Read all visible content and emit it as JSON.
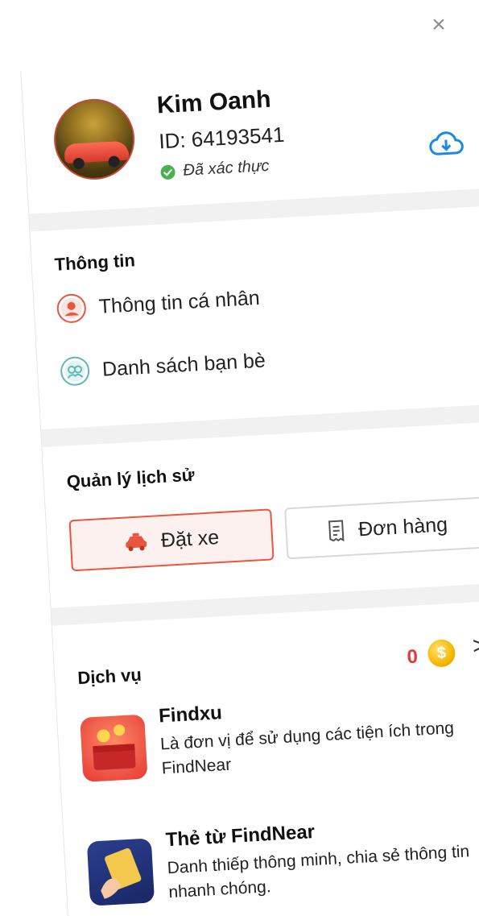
{
  "header": {
    "close_label": "×",
    "name": "Kim Oanh",
    "id_text": "ID: 64193541",
    "verified_text": "Đã xác thực",
    "download_icon": "cloud-download-icon"
  },
  "info": {
    "title": "Thông tin",
    "items": [
      {
        "label": "Thông tin cá nhân",
        "icon": "user-circle-icon"
      },
      {
        "label": "Danh sách bạn bè",
        "icon": "friends-icon"
      }
    ]
  },
  "history": {
    "title": "Quản lý lịch sử",
    "tabs": [
      {
        "label": "Đặt xe",
        "icon": "taxi-icon",
        "active": true
      },
      {
        "label": "Đơn hàng",
        "icon": "receipt-icon",
        "active": false
      }
    ]
  },
  "services": {
    "title": "Dịch vụ",
    "coin_count": "0",
    "coin_symbol": "$",
    "items": [
      {
        "title": "Findxu",
        "description": "Là đơn vị để sử dụng các tiện ích trong FindNear",
        "icon_text": "FindXu"
      },
      {
        "title": "Thẻ từ FindNear",
        "description": "Danh thiếp thông minh, chia sẻ thông tin nhanh chóng."
      }
    ],
    "chevron": ">"
  },
  "colors": {
    "accent": "#e8563f",
    "verified": "#4caf50",
    "download": "#1e88e5",
    "coin": "#f5b800",
    "coin_count": "#e53935"
  }
}
